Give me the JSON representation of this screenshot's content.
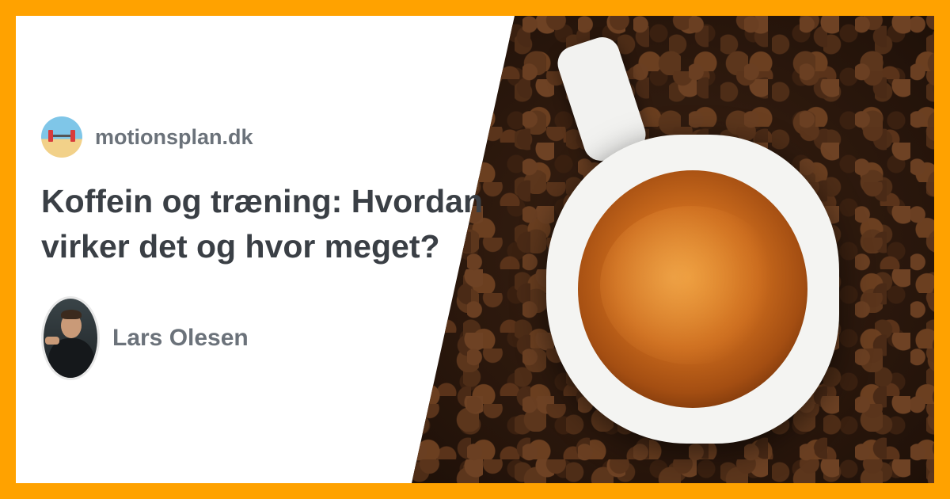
{
  "site": {
    "name": "motionsplan.dk",
    "logo_icon": "dumbbell-beach-logo-icon"
  },
  "article": {
    "title": "Koffein og træning: Hvordan virker det og hvor meget?"
  },
  "author": {
    "name": "Lars Olesen"
  },
  "colors": {
    "border": "#ffa200",
    "title": "#3a3f45",
    "muted": "#6b727a"
  },
  "image": {
    "subject": "espresso-cup-on-coffee-beans"
  }
}
